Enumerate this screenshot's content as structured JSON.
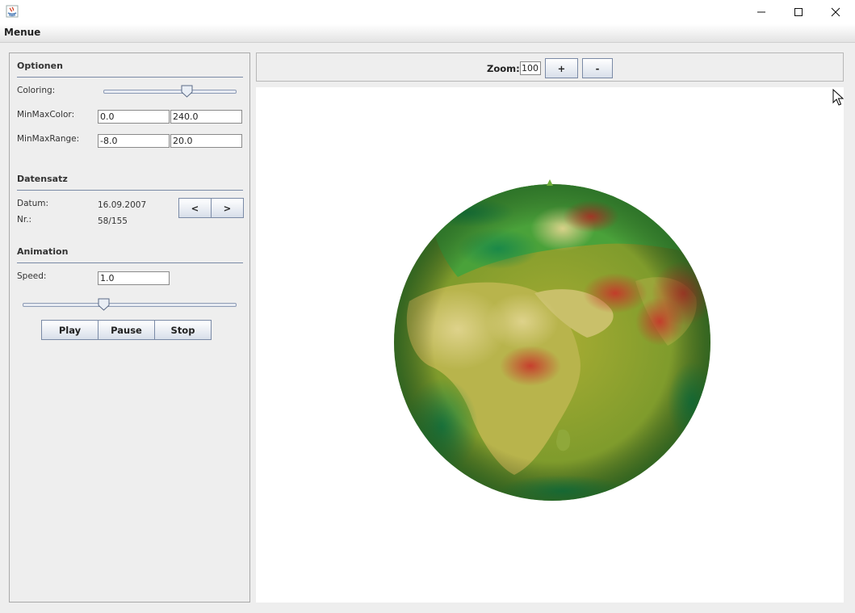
{
  "window": {
    "title": ""
  },
  "menubar": {
    "menu_label": "Menue"
  },
  "options": {
    "title": "Optionen",
    "coloring_label": "Coloring:",
    "coloring_value": 0.64,
    "minmaxcolor_label": "MinMaxColor:",
    "minmaxcolor_min": "0.0",
    "minmaxcolor_max": "240.0",
    "minmaxrange_label": "MinMaxRange:",
    "minmaxrange_min": "-8.0",
    "minmaxrange_max": "20.0"
  },
  "dataset": {
    "title": "Datensatz",
    "date_label": "Datum:",
    "date_value": "16.09.2007",
    "nr_label": "Nr.:",
    "nr_value": "58/155",
    "prev_label": "<",
    "next_label": ">"
  },
  "animation": {
    "title": "Animation",
    "speed_label": "Speed:",
    "speed_value": "1.0",
    "speed_slider_value": 0.37,
    "play_label": "Play",
    "pause_label": "Pause",
    "stop_label": "Stop"
  },
  "toolbar": {
    "zoom_label": "Zoom:",
    "zoom_value": "100",
    "zoom_in_label": "+",
    "zoom_out_label": "-"
  },
  "globe": {
    "view": "Africa and Middle East",
    "colormap": [
      "#1e8c3a",
      "#7fb035",
      "#d8c878",
      "#d0352a"
    ]
  }
}
